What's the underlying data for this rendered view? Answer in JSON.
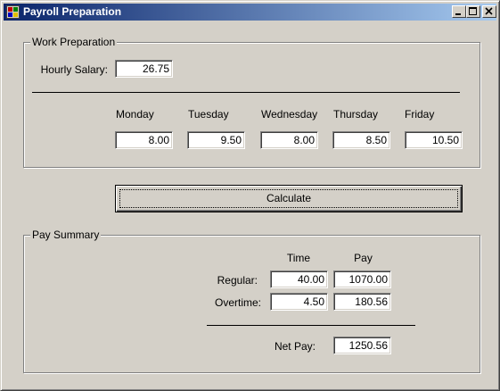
{
  "window": {
    "title": "Payroll Preparation",
    "controls": [
      "minimize",
      "maximize",
      "close"
    ]
  },
  "work_preparation": {
    "group_title": "Work Preparation",
    "hourly_salary_label": "Hourly Salary:",
    "hourly_salary_value": "26.75",
    "days": [
      {
        "label": "Monday",
        "value": "8.00"
      },
      {
        "label": "Tuesday",
        "value": "9.50"
      },
      {
        "label": "Wednesday",
        "value": "8.00"
      },
      {
        "label": "Thursday",
        "value": "8.50"
      },
      {
        "label": "Friday",
        "value": "10.50"
      }
    ]
  },
  "calculate_button": {
    "label": "Calculate"
  },
  "pay_summary": {
    "group_title": "Pay Summary",
    "time_header": "Time",
    "pay_header": "Pay",
    "regular_label": "Regular:",
    "regular_time": "40.00",
    "regular_pay": "1070.00",
    "overtime_label": "Overtime:",
    "overtime_time": "4.50",
    "overtime_pay": "180.56",
    "net_pay_label": "Net Pay:",
    "net_pay_value": "1250.56"
  }
}
